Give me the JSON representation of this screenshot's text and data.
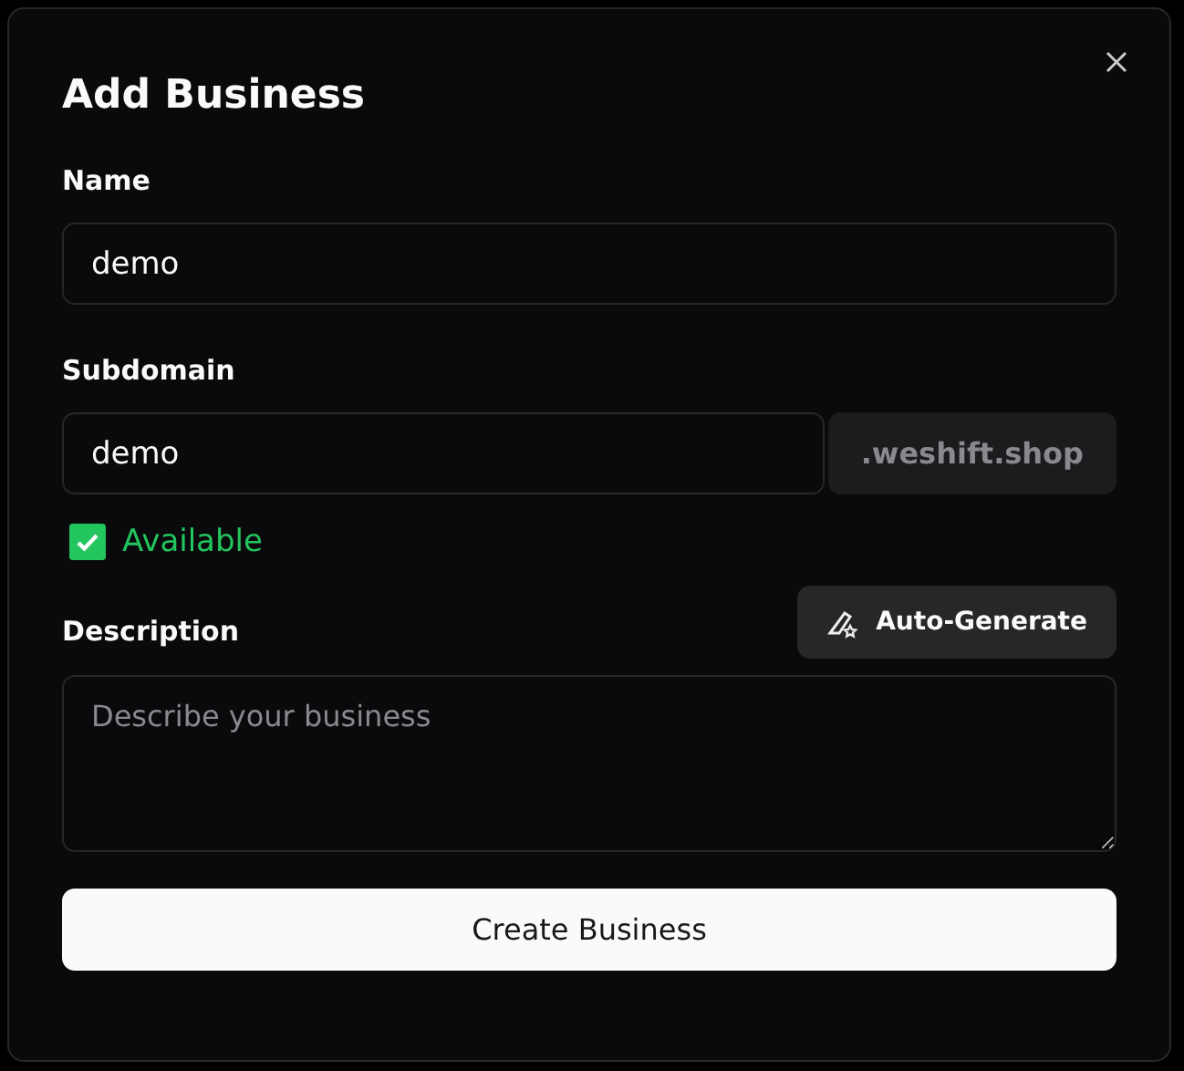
{
  "dialog": {
    "title": "Add Business"
  },
  "fields": [
    {
      "kind": "input",
      "label": "Name",
      "value": "demo"
    },
    {
      "kind": "subdomain",
      "label": "Subdomain",
      "value": "demo",
      "suffix": ".weshift.shop",
      "status": {
        "available": true,
        "text": "Available"
      }
    },
    {
      "kind": "textarea",
      "label": "Description",
      "placeholder": "Describe your business",
      "action": "Auto-Generate"
    }
  ],
  "submit": "Create Business"
}
